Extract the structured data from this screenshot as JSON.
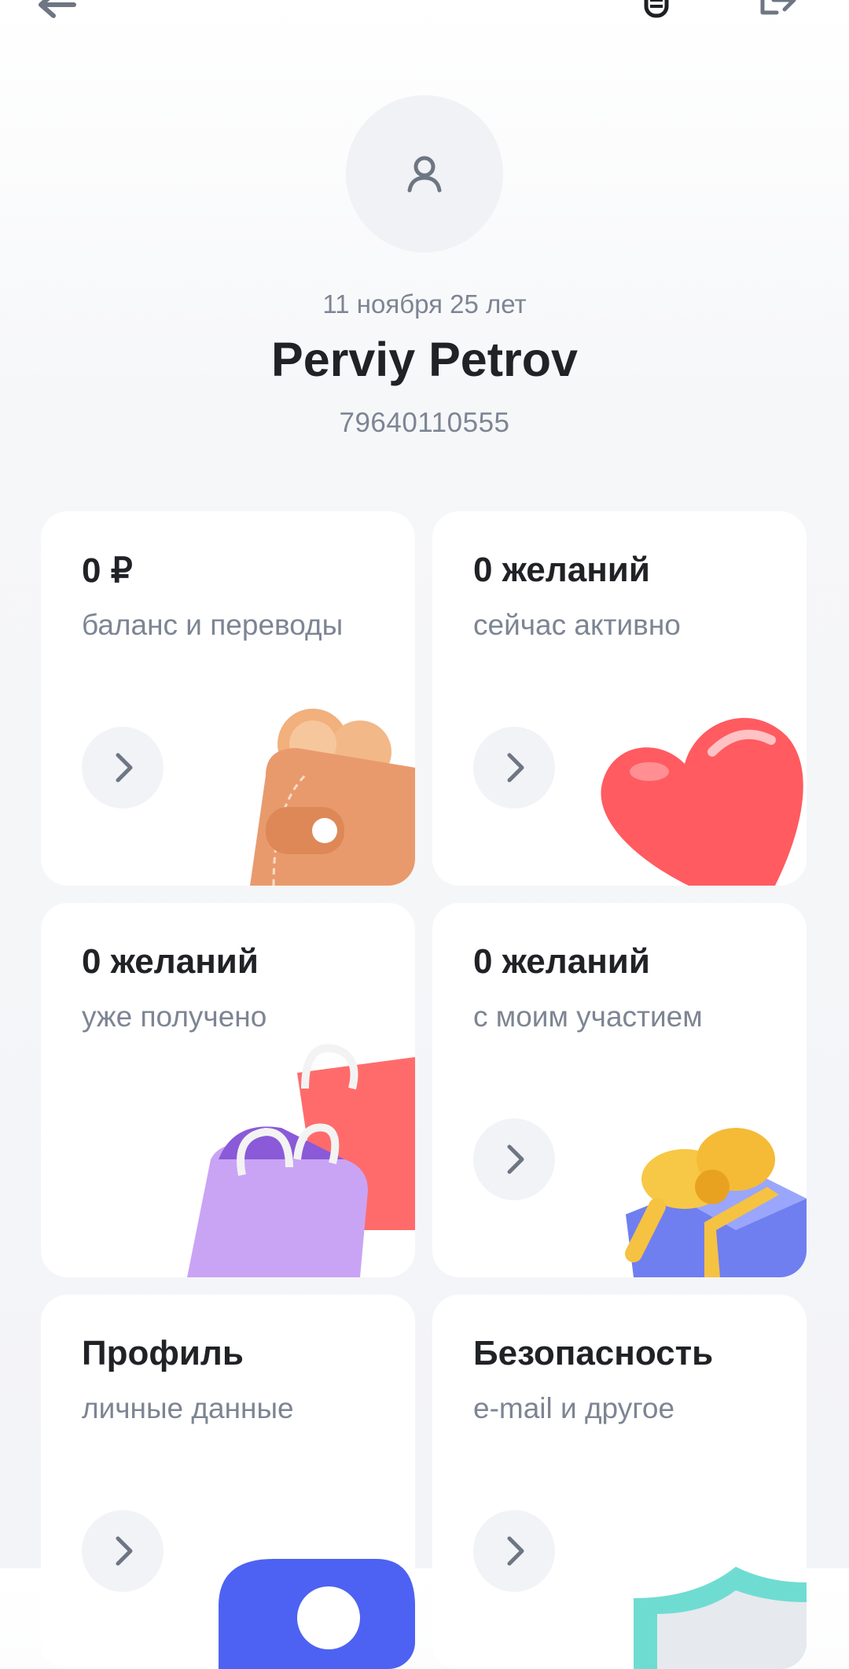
{
  "header": {
    "back_icon": "arrow-left-icon",
    "bug_icon": "bug-icon",
    "logout_icon": "logout-icon"
  },
  "profile": {
    "birth": "11 ноября 25 лет",
    "name": "Perviy Petrov",
    "phone": "79640110555"
  },
  "cards": [
    {
      "title": "0 ₽",
      "subtitle": "баланс и переводы",
      "illustration": "wallet"
    },
    {
      "title": "0 желаний",
      "subtitle": "сейчас активно",
      "illustration": "heart"
    },
    {
      "title": "0 желаний",
      "subtitle": "уже получено",
      "illustration": "shopping-bags"
    },
    {
      "title": "0 желаний",
      "subtitle": "с моим участием",
      "illustration": "gift-box"
    },
    {
      "title": "Профиль",
      "subtitle": "личные данные",
      "illustration": "user-badge"
    },
    {
      "title": "Безопасность",
      "subtitle": "e-mail и другое",
      "illustration": "shield"
    }
  ],
  "colors": {
    "text_primary": "#202226",
    "text_secondary": "#7d8593",
    "card_bg": "#ffffff",
    "button_bg": "#f2f3f6"
  }
}
